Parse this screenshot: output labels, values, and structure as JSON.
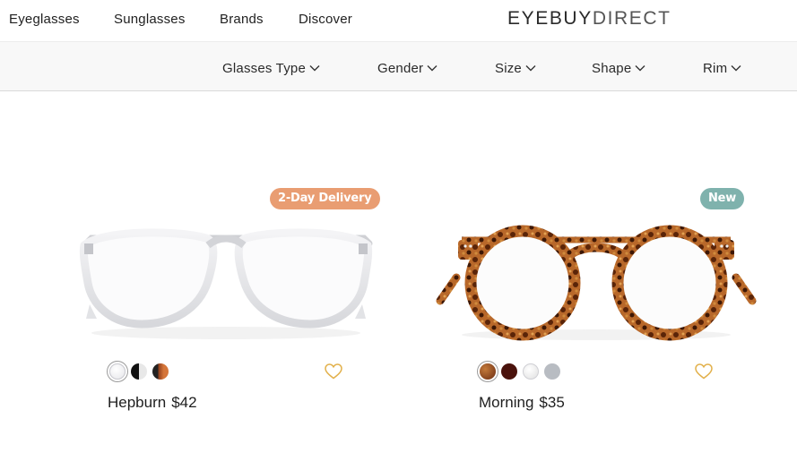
{
  "header": {
    "nav": [
      "Eyeglasses",
      "Sunglasses",
      "Brands",
      "Discover"
    ],
    "logo_bold": "EYEBUY",
    "logo_thin": "DIRECT"
  },
  "filters": [
    "Glasses Type",
    "Gender",
    "Size",
    "Shape",
    "Rim"
  ],
  "products": [
    {
      "name": "Hepburn",
      "price": "$42",
      "badge": "2-Day Delivery",
      "badge_color": "#e99d72",
      "swatches": [
        "#e6e6ea",
        "#111111",
        "#8a3a1a"
      ],
      "frame": "clear"
    },
    {
      "name": "Morning",
      "price": "$35",
      "badge": "New",
      "badge_color": "#7fb2ad",
      "swatches": [
        "#6b2c12",
        "#4a120c",
        "#e0e0e0",
        "#b8bcc2"
      ],
      "frame": "tortoise"
    }
  ],
  "colors": {
    "heart": "#e2b04a",
    "text": "#1e1e1e"
  }
}
